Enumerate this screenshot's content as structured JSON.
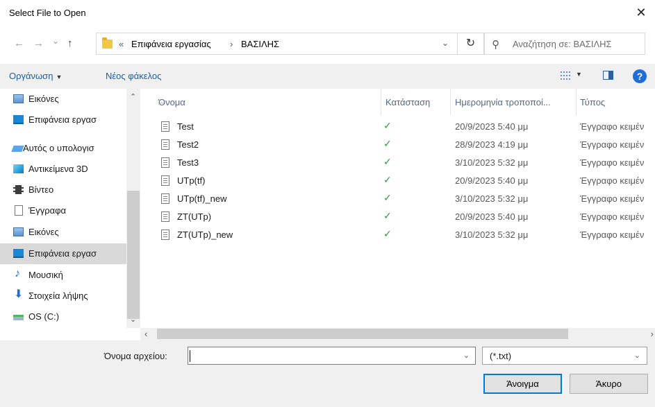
{
  "window": {
    "title": "Select File to Open",
    "close_glyph": "✕"
  },
  "address": {
    "back_glyph": "←",
    "forward_glyph": "→",
    "recent_glyph": "⌄",
    "up_glyph": "↑",
    "overflow": "«",
    "crumbs": [
      "Επιφάνεια εργασίας",
      "ΒΑΣΙΛΗΣ"
    ],
    "separator": "›",
    "dropdown_glyph": "⌄",
    "refresh_glyph": "↻",
    "search_placeholder": "Αναζήτηση σε: ΒΑΣΙΛΗΣ"
  },
  "toolbar": {
    "organize": "Οργάνωση",
    "organize_arrow": "▼",
    "new_folder": "Νέος φάκελος",
    "view_arrow": "▼",
    "help": "?"
  },
  "nav": {
    "scroll_up": "⌃",
    "scroll_down": "⌄",
    "items": [
      {
        "label": "Εικόνες",
        "icon": "pictures-icon"
      },
      {
        "label": "Επιφάνεια εργασ",
        "icon": "desktop-icon"
      },
      {
        "label": "Αυτός ο υπολογισ",
        "icon": "this-pc-icon"
      },
      {
        "label": "Αντικείμενα 3D",
        "icon": "3d-objects-icon"
      },
      {
        "label": "Βίντεο",
        "icon": "videos-icon"
      },
      {
        "label": "Έγγραφα",
        "icon": "documents-icon"
      },
      {
        "label": "Εικόνες",
        "icon": "pictures-icon"
      },
      {
        "label": "Επιφάνεια εργασ",
        "icon": "desktop-icon",
        "selected": true
      },
      {
        "label": "Μουσική",
        "icon": "music-icon",
        "glyph": "♪"
      },
      {
        "label": "Στοιχεία λήψης",
        "icon": "downloads-icon",
        "glyph": "⬇"
      },
      {
        "label": "OS (C:)",
        "icon": "drive-icon"
      }
    ]
  },
  "columns": {
    "name": "Όνομα",
    "status": "Κατάσταση",
    "modified": "Ημερομηνία τροποποί...",
    "type": "Τύπος",
    "sort_glyph": "︿"
  },
  "files": [
    {
      "name": "Test",
      "status": "✓",
      "modified": "20/9/2023 5:40 μμ",
      "type": "Έγγραφο κειμέν"
    },
    {
      "name": "Test2",
      "status": "✓",
      "modified": "28/9/2023 4:19 μμ",
      "type": "Έγγραφο κειμέν"
    },
    {
      "name": "Test3",
      "status": "✓",
      "modified": "3/10/2023 5:32 μμ",
      "type": "Έγγραφο κειμέν"
    },
    {
      "name": "UTp(tf)",
      "status": "✓",
      "modified": "20/9/2023 5:40 μμ",
      "type": "Έγγραφο κειμέν"
    },
    {
      "name": "UTp(tf)_new",
      "status": "✓",
      "modified": "3/10/2023 5:32 μμ",
      "type": "Έγγραφο κειμέν"
    },
    {
      "name": "ZT(UTp)",
      "status": "✓",
      "modified": "20/9/2023 5:40 μμ",
      "type": "Έγγραφο κειμέν"
    },
    {
      "name": "ZT(UTp)_new",
      "status": "✓",
      "modified": "3/10/2023 5:32 μμ",
      "type": "Έγγραφο κειμέν"
    }
  ],
  "hscroll": {
    "left": "‹",
    "right": "›"
  },
  "footer": {
    "filename_label": "Όνομα αρχείου:",
    "filename_value": "",
    "dropdown_glyph": "⌄",
    "filetype": "(*.txt)",
    "open_button": "Άνοιγμα",
    "cancel_button": "Άκυρο"
  },
  "colors": {
    "accent": "#0078d7",
    "link": "#1a5fa8",
    "status_ok": "#2c9a3a",
    "selection": "#d9d9d9"
  }
}
